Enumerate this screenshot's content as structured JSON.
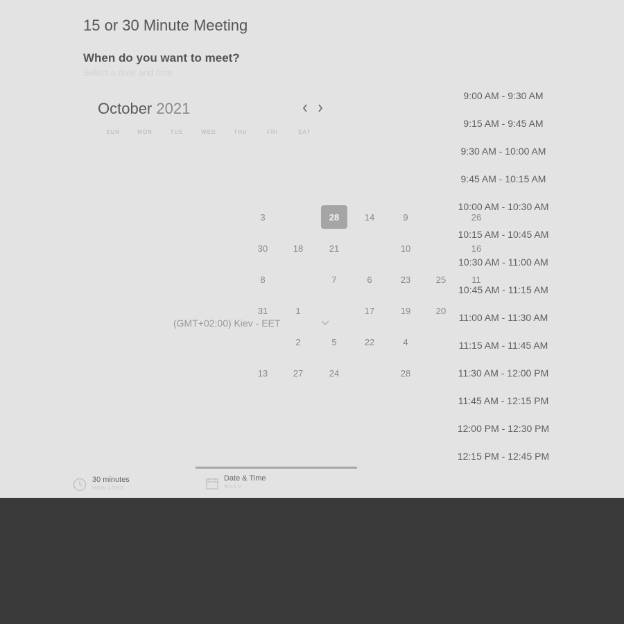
{
  "title": "15 or 30 Minute Meeting",
  "question": "When do you want to meet?",
  "hint": "Select a date and time",
  "calendar": {
    "month": "October",
    "year": "2021",
    "weekdays": [
      "SUN",
      "MON",
      "TUE",
      "WED",
      "THU",
      "FRI",
      "SAT"
    ],
    "rows": [
      [
        "3",
        "",
        "28",
        "14",
        "9",
        "",
        "26"
      ],
      [
        "30",
        "18",
        "21",
        "",
        "10",
        "",
        "16"
      ],
      [
        "8",
        "",
        "7",
        "6",
        "23",
        "25",
        "11"
      ],
      [
        "31",
        "1",
        "",
        "17",
        "19",
        "20",
        ""
      ],
      [
        "",
        "2",
        "5",
        "22",
        "4",
        "",
        ""
      ],
      [
        "13",
        "27",
        "24",
        "",
        "28",
        "",
        ""
      ]
    ],
    "selected": "28"
  },
  "timezone": "(GMT+02:00) Kiev - EET",
  "slots": [
    "9:00 AM - 9:30 AM",
    "9:15 AM - 9:45 AM",
    "9:30 AM - 10:00 AM",
    "9:45 AM - 10:15 AM",
    "10:00 AM - 10:30 AM",
    "10:15 AM - 10:45 AM",
    "10:30 AM - 11:00 AM",
    "10:45 AM - 11:15 AM",
    "11:00 AM - 11:30 AM",
    "11:15 AM - 11:45 AM",
    "11:30 AM - 12:00 PM",
    "11:45 AM - 12:15 PM",
    "12:00 PM - 12:30 PM",
    "12:15 PM - 12:45 PM"
  ],
  "summary": {
    "duration": {
      "label": "30 minutes",
      "sub": "HOW LONG",
      "icon": "clock-icon"
    },
    "datetime": {
      "label": "Date & Time",
      "sub": "WHEN",
      "icon": "calendar-icon"
    }
  },
  "colors": {
    "background": "#e3e3e3",
    "footer_band": "#3a3a3a",
    "selected_day": "#a5a5a5"
  }
}
